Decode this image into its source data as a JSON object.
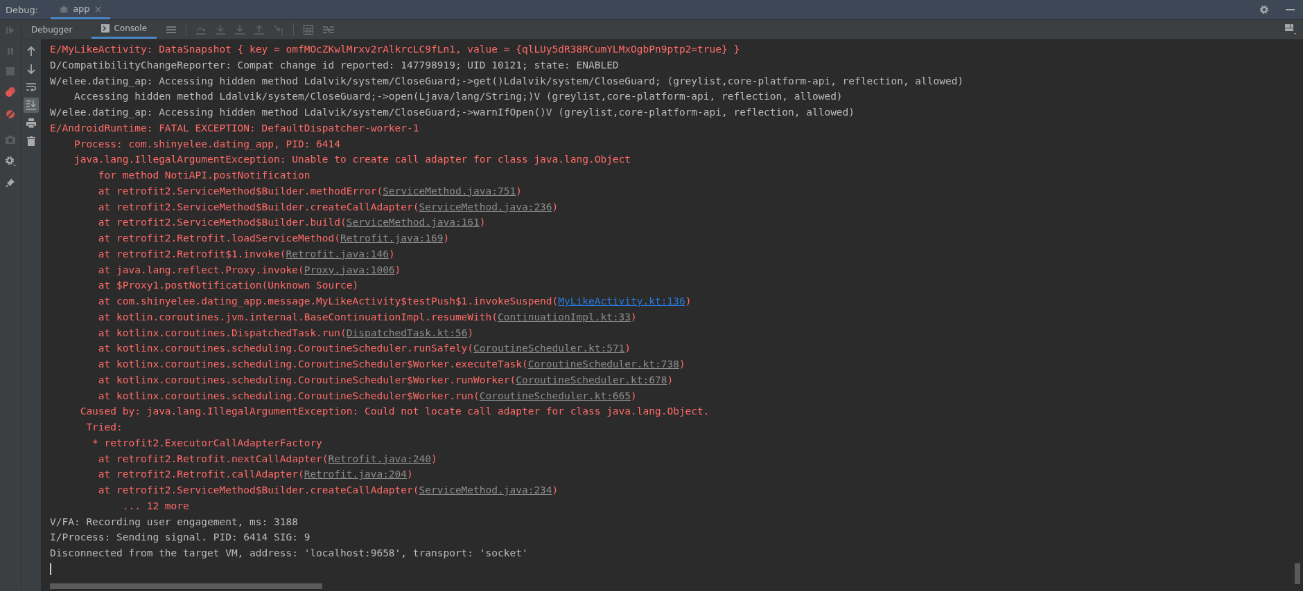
{
  "panel": {
    "title": "Debug:",
    "tabs": [
      {
        "label": "app",
        "close": "×",
        "selected": true
      }
    ]
  },
  "subtabs": [
    {
      "label": "Debugger",
      "selected": false
    },
    {
      "label": "Console",
      "selected": true
    }
  ],
  "console": {
    "lines": [
      {
        "kind": "error",
        "segments": [
          {
            "kind": "plain",
            "text": "E/MyLikeActivity: DataSnapshot { key = omfMOcZKwlMrxv2rAlkrcLC9fLn1, value = {qlLUy5dR38RCumYLMxOgbPn9ptp2=true} }"
          }
        ]
      },
      {
        "kind": "info",
        "segments": [
          {
            "kind": "plain",
            "text": "D/CompatibilityChangeReporter: Compat change id reported: 147798919; UID 10121; state: ENABLED"
          }
        ]
      },
      {
        "kind": "info",
        "segments": [
          {
            "kind": "plain",
            "text": "W/elee.dating_ap: Accessing hidden method Ldalvik/system/CloseGuard;->get()Ldalvik/system/CloseGuard; (greylist,core-platform-api, reflection, allowed)"
          }
        ]
      },
      {
        "kind": "info",
        "segments": [
          {
            "kind": "plain",
            "text": "    Accessing hidden method Ldalvik/system/CloseGuard;->open(Ljava/lang/String;)V (greylist,core-platform-api, reflection, allowed)"
          }
        ]
      },
      {
        "kind": "info",
        "segments": [
          {
            "kind": "plain",
            "text": "W/elee.dating_ap: Accessing hidden method Ldalvik/system/CloseGuard;->warnIfOpen()V (greylist,core-platform-api, reflection, allowed)"
          }
        ]
      },
      {
        "kind": "error",
        "segments": [
          {
            "kind": "plain",
            "text": "E/AndroidRuntime: FATAL EXCEPTION: DefaultDispatcher-worker-1"
          }
        ]
      },
      {
        "kind": "error",
        "segments": [
          {
            "kind": "plain",
            "text": "    Process: com.shinyelee.dating_app, PID: 6414"
          }
        ]
      },
      {
        "kind": "error",
        "segments": [
          {
            "kind": "plain",
            "text": "    java.lang.IllegalArgumentException: Unable to create call adapter for class java.lang.Object"
          }
        ]
      },
      {
        "kind": "error",
        "segments": [
          {
            "kind": "plain",
            "text": "        for method NotiAPI.postNotification"
          }
        ]
      },
      {
        "kind": "error",
        "segments": [
          {
            "kind": "plain",
            "text": "        at retrofit2.ServiceMethod$Builder.methodError("
          },
          {
            "kind": "link",
            "text": "ServiceMethod.java:751"
          },
          {
            "kind": "plain",
            "text": ")"
          }
        ]
      },
      {
        "kind": "error",
        "segments": [
          {
            "kind": "plain",
            "text": "        at retrofit2.ServiceMethod$Builder.createCallAdapter("
          },
          {
            "kind": "link",
            "text": "ServiceMethod.java:236"
          },
          {
            "kind": "plain",
            "text": ")"
          }
        ]
      },
      {
        "kind": "error",
        "segments": [
          {
            "kind": "plain",
            "text": "        at retrofit2.ServiceMethod$Builder.build("
          },
          {
            "kind": "link",
            "text": "ServiceMethod.java:161"
          },
          {
            "kind": "plain",
            "text": ")"
          }
        ]
      },
      {
        "kind": "error",
        "segments": [
          {
            "kind": "plain",
            "text": "        at retrofit2.Retrofit.loadServiceMethod("
          },
          {
            "kind": "link",
            "text": "Retrofit.java:169"
          },
          {
            "kind": "plain",
            "text": ")"
          }
        ]
      },
      {
        "kind": "error",
        "segments": [
          {
            "kind": "plain",
            "text": "        at retrofit2.Retrofit$1.invoke("
          },
          {
            "kind": "link",
            "text": "Retrofit.java:146"
          },
          {
            "kind": "plain",
            "text": ")"
          }
        ]
      },
      {
        "kind": "error",
        "segments": [
          {
            "kind": "plain",
            "text": "        at java.lang.reflect.Proxy.invoke("
          },
          {
            "kind": "link",
            "text": "Proxy.java:1006"
          },
          {
            "kind": "plain",
            "text": ")"
          }
        ]
      },
      {
        "kind": "error",
        "segments": [
          {
            "kind": "plain",
            "text": "        at $Proxy1.postNotification(Unknown Source)"
          }
        ]
      },
      {
        "kind": "error",
        "segments": [
          {
            "kind": "plain",
            "text": "        at com.shinyelee.dating_app.message.MyLikeActivity$testPush$1.invokeSuspend("
          },
          {
            "kind": "app_link",
            "text": "MyLikeActivity.kt:136"
          },
          {
            "kind": "plain",
            "text": ")"
          }
        ]
      },
      {
        "kind": "error",
        "segments": [
          {
            "kind": "plain",
            "text": "        at kotlin.coroutines.jvm.internal.BaseContinuationImpl.resumeWith("
          },
          {
            "kind": "link",
            "text": "ContinuationImpl.kt:33"
          },
          {
            "kind": "plain",
            "text": ")"
          }
        ]
      },
      {
        "kind": "error",
        "segments": [
          {
            "kind": "plain",
            "text": "        at kotlinx.coroutines.DispatchedTask.run("
          },
          {
            "kind": "link",
            "text": "DispatchedTask.kt:56"
          },
          {
            "kind": "plain",
            "text": ")"
          }
        ]
      },
      {
        "kind": "error",
        "segments": [
          {
            "kind": "plain",
            "text": "        at kotlinx.coroutines.scheduling.CoroutineScheduler.runSafely("
          },
          {
            "kind": "link",
            "text": "CoroutineScheduler.kt:571"
          },
          {
            "kind": "plain",
            "text": ")"
          }
        ]
      },
      {
        "kind": "error",
        "segments": [
          {
            "kind": "plain",
            "text": "        at kotlinx.coroutines.scheduling.CoroutineScheduler$Worker.executeTask("
          },
          {
            "kind": "link",
            "text": "CoroutineScheduler.kt:738"
          },
          {
            "kind": "plain",
            "text": ")"
          }
        ]
      },
      {
        "kind": "error",
        "segments": [
          {
            "kind": "plain",
            "text": "        at kotlinx.coroutines.scheduling.CoroutineScheduler$Worker.runWorker("
          },
          {
            "kind": "link",
            "text": "CoroutineScheduler.kt:678"
          },
          {
            "kind": "plain",
            "text": ")"
          }
        ]
      },
      {
        "kind": "error",
        "segments": [
          {
            "kind": "plain",
            "text": "        at kotlinx.coroutines.scheduling.CoroutineScheduler$Worker.run("
          },
          {
            "kind": "link",
            "text": "CoroutineScheduler.kt:665"
          },
          {
            "kind": "plain",
            "text": ")"
          }
        ]
      },
      {
        "kind": "error",
        "segments": [
          {
            "kind": "plain",
            "text": "     Caused by: java.lang.IllegalArgumentException: Could not locate call adapter for class java.lang.Object."
          }
        ]
      },
      {
        "kind": "error",
        "segments": [
          {
            "kind": "plain",
            "text": "      Tried:"
          }
        ]
      },
      {
        "kind": "error",
        "segments": [
          {
            "kind": "plain",
            "text": "       * retrofit2.ExecutorCallAdapterFactory"
          }
        ]
      },
      {
        "kind": "error",
        "segments": [
          {
            "kind": "plain",
            "text": "        at retrofit2.Retrofit.nextCallAdapter("
          },
          {
            "kind": "link",
            "text": "Retrofit.java:240"
          },
          {
            "kind": "plain",
            "text": ")"
          }
        ]
      },
      {
        "kind": "error",
        "segments": [
          {
            "kind": "plain",
            "text": "        at retrofit2.Retrofit.callAdapter("
          },
          {
            "kind": "link",
            "text": "Retrofit.java:204"
          },
          {
            "kind": "plain",
            "text": ")"
          }
        ]
      },
      {
        "kind": "error",
        "segments": [
          {
            "kind": "plain",
            "text": "        at retrofit2.ServiceMethod$Builder.createCallAdapter("
          },
          {
            "kind": "link",
            "text": "ServiceMethod.java:234"
          },
          {
            "kind": "plain",
            "text": ")"
          }
        ]
      },
      {
        "kind": "error",
        "segments": [
          {
            "kind": "plain",
            "text": "            ... 12 more"
          }
        ]
      },
      {
        "kind": "info",
        "segments": [
          {
            "kind": "plain",
            "text": "V/FA: Recording user engagement, ms: 3188"
          }
        ]
      },
      {
        "kind": "info",
        "segments": [
          {
            "kind": "plain",
            "text": "I/Process: Sending signal. PID: 6414 SIG: 9"
          }
        ]
      },
      {
        "kind": "info",
        "segments": [
          {
            "kind": "plain",
            "text": "Disconnected from the target VM, address: 'localhost:9658', transport: 'socket'"
          }
        ]
      }
    ]
  },
  "side_tools": [
    {
      "kind": "up",
      "selected": false
    },
    {
      "kind": "down",
      "selected": false
    },
    {
      "kind": "wrap",
      "selected": false
    },
    {
      "kind": "scroll-end",
      "selected": true
    },
    {
      "kind": "print",
      "selected": false
    },
    {
      "kind": "trash",
      "selected": false
    }
  ]
}
